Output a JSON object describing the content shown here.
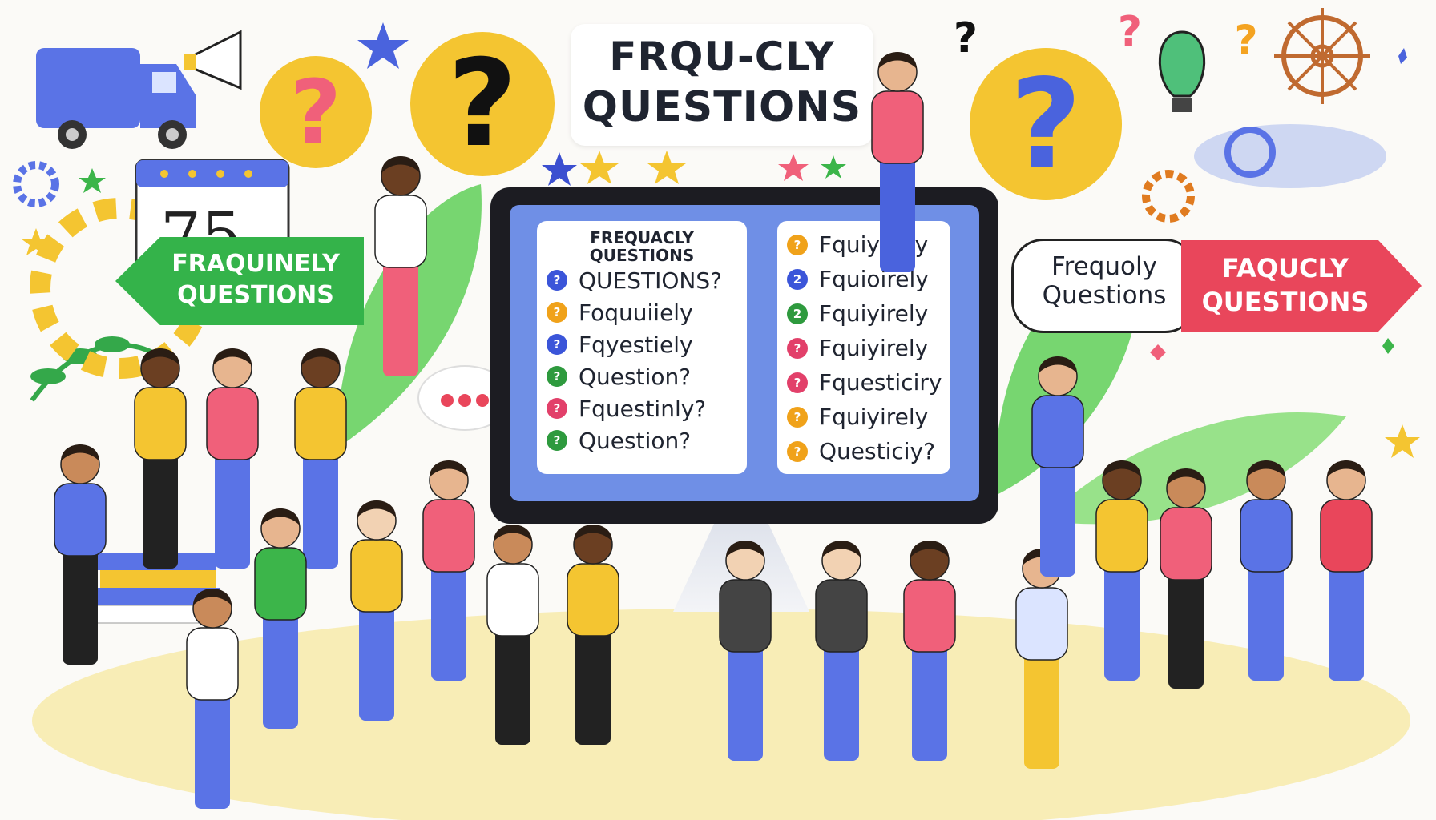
{
  "title": {
    "line1": "FRQU-CLY",
    "line2": "QUESTIONS"
  },
  "signs": {
    "left": {
      "line1": "FRAQUINELY",
      "line2": "QUESTIONS"
    },
    "right_bubble": {
      "line1": "Frequoly",
      "line2": "Questions"
    },
    "right": {
      "line1": "FAQUCLY",
      "line2": "QUESTIONS"
    }
  },
  "calendar": {
    "number": "75"
  },
  "monitor": {
    "left_panel": {
      "heading1": "FREQUACLY",
      "heading2": "QUESTIONS",
      "items": [
        {
          "text": "QUESTIONS?",
          "color": "#3b55d9",
          "icon": "?"
        },
        {
          "text": "Foquuiiely",
          "color": "#f0a21a",
          "icon": "?"
        },
        {
          "text": "Fqyestiely",
          "color": "#3b55d9",
          "icon": "?"
        },
        {
          "text": "Question?",
          "color": "#2e9a3e",
          "icon": "?"
        },
        {
          "text": "Fquestinly?",
          "color": "#e2406a",
          "icon": "?"
        },
        {
          "text": "Question?",
          "color": "#2e9a3e",
          "icon": "?"
        }
      ]
    },
    "right_panel": {
      "items": [
        {
          "text": "Fquiyirely",
          "color": "#f0a21a",
          "icon": "?"
        },
        {
          "text": "Fquioirely",
          "color": "#3b55d9",
          "icon": "2"
        },
        {
          "text": "Fquiyirely",
          "color": "#2e9a3e",
          "icon": "2"
        },
        {
          "text": "Fquiyirely",
          "color": "#e2406a",
          "icon": "?"
        },
        {
          "text": "Fquesticiry",
          "color": "#e2406a",
          "icon": "?"
        },
        {
          "text": "Fquiyirely",
          "color": "#f0a21a",
          "icon": "?"
        },
        {
          "text": "Questiciy?",
          "color": "#f0a21a",
          "icon": "?"
        }
      ]
    }
  },
  "colors": {
    "yellow": "#f4c531",
    "pink": "#f0607a",
    "blue": "#4a63dd",
    "green": "#3cb54a",
    "red": "#e9465b"
  }
}
